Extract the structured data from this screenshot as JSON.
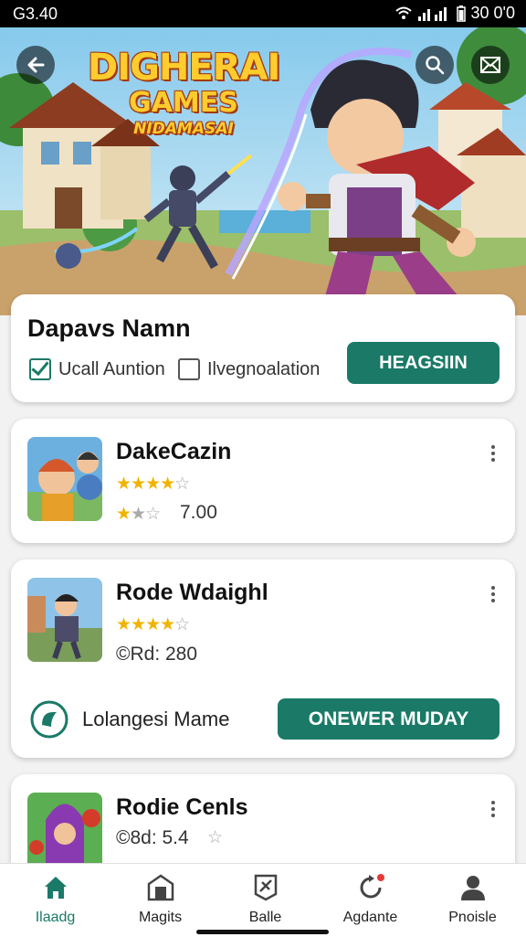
{
  "status_bar": {
    "time": "G3.40",
    "right_text": "30 0'0"
  },
  "hero": {
    "title_line1": "DIGHERAI",
    "title_line2": "GAMES",
    "title_line3": "NIDAMASAI",
    "back_icon": "arrow-left-icon",
    "search_icon": "search-icon",
    "share_icon": "envelope-icon"
  },
  "top_card": {
    "title": "Dapavs Namn",
    "option1": {
      "label": "Ucall Auntion",
      "checked": true
    },
    "option2": {
      "label": "Ilvegnoalation",
      "checked": false
    },
    "button_label": "HEAGSIIN"
  },
  "items": [
    {
      "title": "DakeCazin",
      "rating": 4,
      "meta": "7.00",
      "meta_rating": 2
    },
    {
      "title": "Rode Wdaighl",
      "rating": 4,
      "meta": "©Rd: 280",
      "footer_label": "Lolangesi Mame",
      "footer_button": "ONEWER MUDAY"
    },
    {
      "title": "Rodie Cenls",
      "meta": "©8d: 5.4"
    }
  ],
  "bottom_nav": [
    {
      "label": "Ilaadg",
      "icon": "home-icon",
      "active": true
    },
    {
      "label": "Magits",
      "icon": "shop-icon",
      "active": false
    },
    {
      "label": "Balle",
      "icon": "badge-icon",
      "active": false
    },
    {
      "label": "Agdante",
      "icon": "refresh-icon",
      "active": false,
      "badge": true
    },
    {
      "label": "Pnoisle",
      "icon": "profile-icon",
      "active": false
    }
  ],
  "colors": {
    "accent": "#1a7a67",
    "star": "#f0b400"
  }
}
